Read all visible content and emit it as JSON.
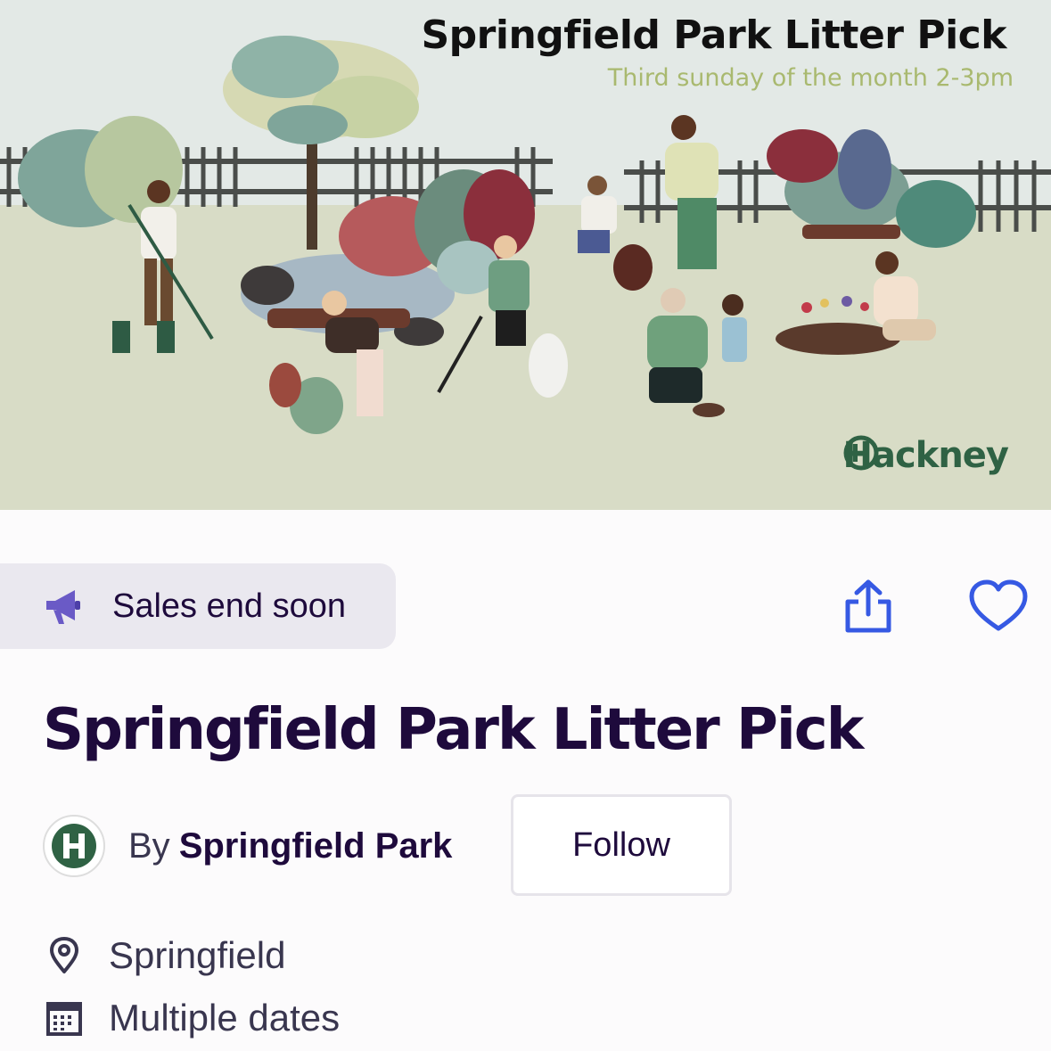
{
  "banner": {
    "title": "Springfield Park Litter Pick",
    "subtitle": "Third sunday of the month 2-3pm",
    "brand": "Hackney",
    "brand_color": "#2f6244",
    "subtitle_color": "#a9b96f"
  },
  "badge": {
    "icon": "megaphone-icon",
    "label": "Sales end soon"
  },
  "actions": {
    "share_icon": "share-icon",
    "like_icon": "heart-icon",
    "accent": "#3659e3"
  },
  "event": {
    "title": "Springfield Park Litter Pick"
  },
  "organizer": {
    "by": "By",
    "name": "Springfield Park",
    "avatar_icon": "hackney-logo",
    "follow_label": "Follow"
  },
  "details": {
    "location": "Springfield",
    "location_icon": "location-pin-icon",
    "dates": "Multiple dates",
    "dates_icon": "calendar-icon"
  }
}
